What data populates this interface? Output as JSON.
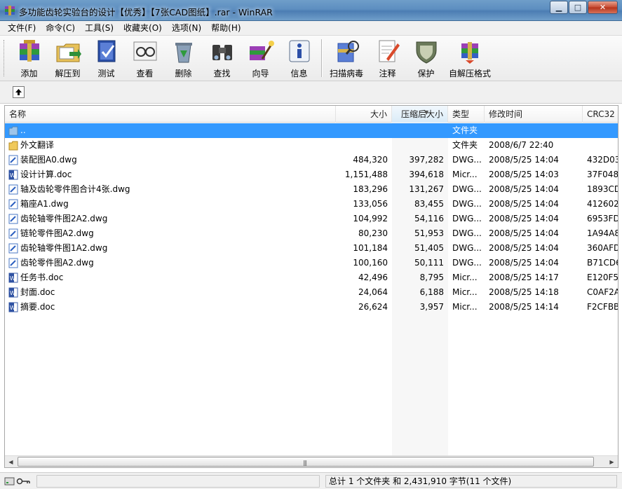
{
  "window": {
    "title": "多功能齿轮实验台的设计【优秀】【7张CAD图纸】.rar - WinRAR"
  },
  "menu": [
    "文件(F)",
    "命令(C)",
    "工具(S)",
    "收藏夹(O)",
    "选项(N)",
    "帮助(H)"
  ],
  "toolbar": {
    "add": "添加",
    "extract": "解压到",
    "test": "测试",
    "view": "查看",
    "delete": "删除",
    "find": "查找",
    "wizard": "向导",
    "info": "信息",
    "scan": "扫描病毒",
    "comment": "注释",
    "protect": "保护",
    "sfx": "自解压格式"
  },
  "columns": {
    "name": "名称",
    "size": "大小",
    "packed": "压缩后大小",
    "type": "类型",
    "modified": "修改时间",
    "crc": "CRC32"
  },
  "files": [
    {
      "name": "..",
      "size": "",
      "packed": "",
      "type": "文件夹",
      "modified": "",
      "crc": "",
      "kind": "up"
    },
    {
      "name": "外文翻译",
      "size": "",
      "packed": "",
      "type": "文件夹",
      "modified": "2008/6/7 22:40",
      "crc": "",
      "kind": "folder"
    },
    {
      "name": "装配图A0.dwg",
      "size": "484,320",
      "packed": "397,282",
      "type": "DWG...",
      "modified": "2008/5/25 14:04",
      "crc": "432D03",
      "kind": "dwg"
    },
    {
      "name": "设计计算.doc",
      "size": "1,151,488",
      "packed": "394,618",
      "type": "Micr...",
      "modified": "2008/5/25 14:03",
      "crc": "37F048",
      "kind": "doc"
    },
    {
      "name": "轴及齿轮零件图合计4张.dwg",
      "size": "183,296",
      "packed": "131,267",
      "type": "DWG...",
      "modified": "2008/5/25 14:04",
      "crc": "1893CD",
      "kind": "dwg"
    },
    {
      "name": "箱座A1.dwg",
      "size": "133,056",
      "packed": "83,455",
      "type": "DWG...",
      "modified": "2008/5/25 14:04",
      "crc": "412602",
      "kind": "dwg"
    },
    {
      "name": "齿轮轴零件图2A2.dwg",
      "size": "104,992",
      "packed": "54,116",
      "type": "DWG...",
      "modified": "2008/5/25 14:04",
      "crc": "6953FD",
      "kind": "dwg"
    },
    {
      "name": "链轮零件图A2.dwg",
      "size": "80,230",
      "packed": "51,953",
      "type": "DWG...",
      "modified": "2008/5/25 14:04",
      "crc": "1A94A8",
      "kind": "dwg"
    },
    {
      "name": "齿轮轴零件图1A2.dwg",
      "size": "101,184",
      "packed": "51,405",
      "type": "DWG...",
      "modified": "2008/5/25 14:04",
      "crc": "360AFD",
      "kind": "dwg"
    },
    {
      "name": "齿轮零件图A2.dwg",
      "size": "100,160",
      "packed": "50,111",
      "type": "DWG...",
      "modified": "2008/5/25 14:04",
      "crc": "B71CD6",
      "kind": "dwg"
    },
    {
      "name": "任务书.doc",
      "size": "42,496",
      "packed": "8,795",
      "type": "Micr...",
      "modified": "2008/5/25 14:17",
      "crc": "E120F5.",
      "kind": "doc"
    },
    {
      "name": "封面.doc",
      "size": "24,064",
      "packed": "6,188",
      "type": "Micr...",
      "modified": "2008/5/25 14:18",
      "crc": "C0AF2A",
      "kind": "doc"
    },
    {
      "name": "摘要.doc",
      "size": "26,624",
      "packed": "3,957",
      "type": "Micr...",
      "modified": "2008/5/25 14:14",
      "crc": "F2CFBB",
      "kind": "doc"
    }
  ],
  "status": {
    "summary": "总计 1 个文件夹 和 2,431,910 字节(11 个文件)"
  },
  "colors": {
    "selection": "#3399ff",
    "titlebar": "#5d8ec0"
  }
}
